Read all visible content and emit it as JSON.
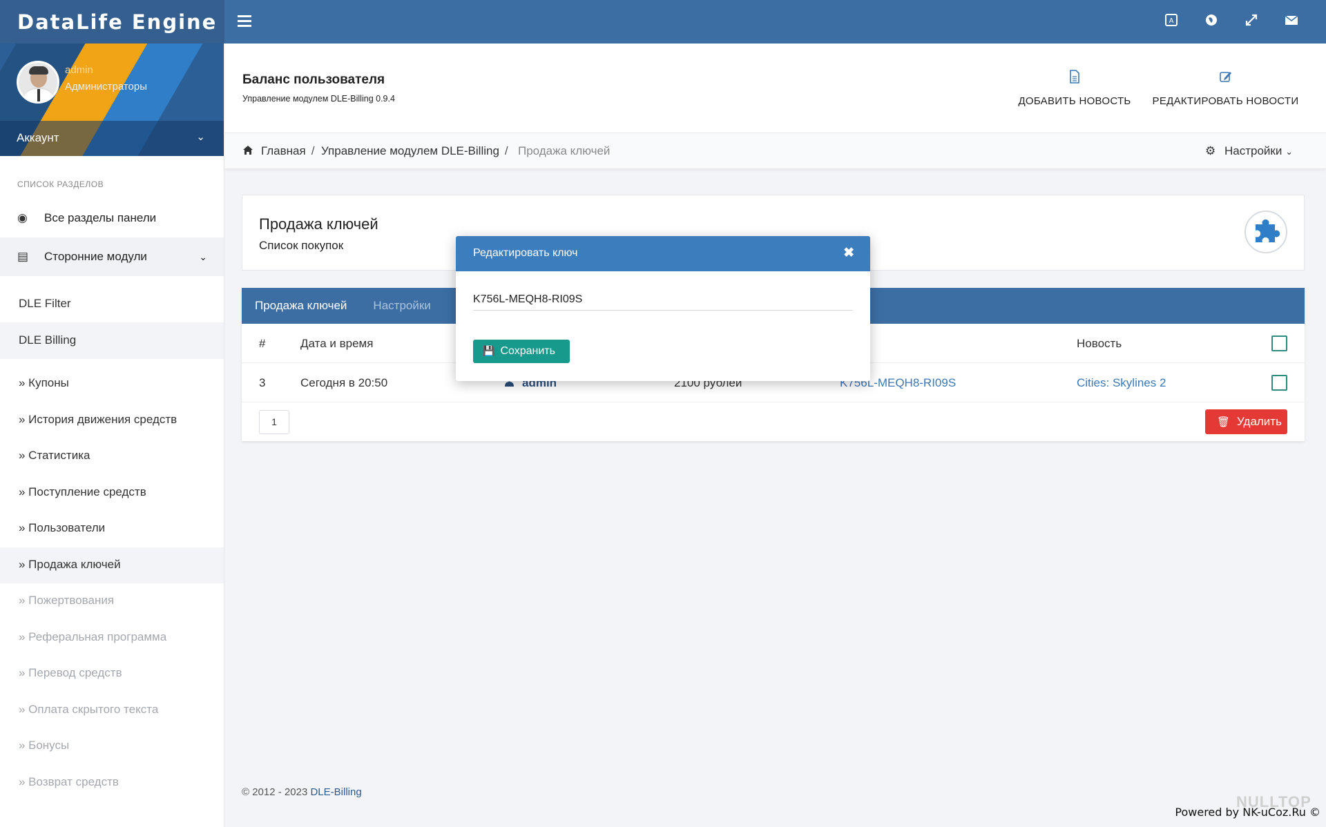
{
  "brand": "DataLife Engine",
  "profile": {
    "name": "admin",
    "role": "Администраторы",
    "account_label": "Аккаунт"
  },
  "sidebar": {
    "section_title": "СПИСОК РАЗДЕЛОВ",
    "main_items": [
      "Все разделы панели",
      "Сторонние модули"
    ],
    "modules": [
      "DLE Filter",
      "DLE Billing"
    ],
    "billing_items": [
      "» Купоны",
      "» История движения средств",
      "» Статистика",
      "» Поступление средств",
      "» Пользователи",
      "» Продажа ключей",
      "» Пожертвования",
      "» Реферальная программа",
      "» Перевод средств",
      "» Оплата скрытого текста",
      "» Бонусы",
      "» Возврат средств"
    ]
  },
  "header": {
    "title": "Баланс пользователя",
    "subtitle": "Управление модулем DLE-Billing 0.9.4",
    "add_news": "ДОБАВИТЬ НОВОСТЬ",
    "edit_news": "РЕДАКТИРОВАТЬ НОВОСТИ"
  },
  "breadcrumb": {
    "items": [
      "Главная",
      "Управление модулем DLE-Billing",
      "Продажа ключей"
    ],
    "settings": "Настройки"
  },
  "panel": {
    "title": "Продажа ключей",
    "subtitle": "Список покупок"
  },
  "tabs": [
    "Продажа ключей",
    "Настройки"
  ],
  "table": {
    "headers": {
      "num": "#",
      "date": "Дата и время",
      "news": "Новость"
    },
    "rows": [
      {
        "num": "3",
        "date": "Сегодня в 20:50",
        "user": "admin",
        "sum": "2100 рублей",
        "key": "K756L-MEQH8-RI09S",
        "news": "Cities: Skylines 2"
      }
    ]
  },
  "pagination": {
    "current": "1"
  },
  "delete_label": "Удалить",
  "modal": {
    "title": "Редактировать ключ",
    "value": "K756L-MEQH8-RI09S",
    "save_label": "Сохранить"
  },
  "footer": {
    "copyright": "© 2012 - 2023",
    "link": "DLE-Billing"
  },
  "powered": "Powered by NK-uCoz.Ru ©",
  "watermark": "NULLTOP",
  "colors": {
    "primary": "#3c6ea4",
    "modal_header": "#3c7dbd",
    "save": "#17998b",
    "delete": "#e53935"
  }
}
